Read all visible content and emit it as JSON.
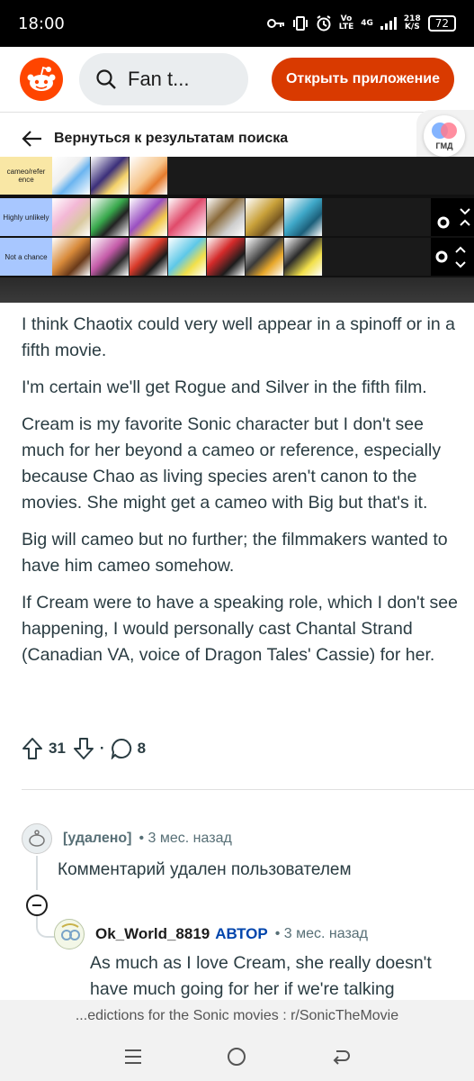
{
  "status": {
    "time": "18:00",
    "network_top": "Vo",
    "network_bottom": "LTE",
    "signal_label": "4G",
    "speed_top": "218",
    "speed_bottom": "K/S",
    "battery": "72"
  },
  "header": {
    "search_text": "Fan t...",
    "open_app_label": "Открыть приложение"
  },
  "nav": {
    "back_label": "Вернуться к результатам поиска"
  },
  "widgets": {
    "gmd_label": "ГМД"
  },
  "tierlist": {
    "rows": [
      {
        "label": "cameo/refer ence",
        "color": "#f9e7a5",
        "count": 3
      },
      {
        "label": "Highly unlikely",
        "color": "#a8c7ff",
        "count": 6
      },
      {
        "label": "Not a chance",
        "color": "#a8c7ff",
        "count": 6
      }
    ]
  },
  "post": {
    "paragraphs": [
      "I think Chaotix could very well appear in a spinoff or in a fifth movie.",
      "I'm certain we'll get Rogue and Silver in the fifth film.",
      "Cream is my favorite Sonic character but I don't see much for her beyond a cameo or reference, especially because Chao as living species aren't canon to the movies. She might get a cameo with Big but that's it.",
      "Big will cameo but no further; the filmmakers wanted to have him cameo somehow.",
      "If Cream were to have a speaking role, which I don't see happening, I would personally cast Chantal Strand (Canadian VA, voice of Dragon Tales' Cassie) for her."
    ],
    "upvotes": "31",
    "separator": "·",
    "comments": "8"
  },
  "comments": [
    {
      "author": "[удалено]",
      "meta": "• 3 мес. назад",
      "text": "Комментарий удален пользователем"
    },
    {
      "author": "Ok_World_8819",
      "badge": "АВТОР",
      "meta": "• 3 мес. назад",
      "text": "As much as I love Cream, she really doesn't have much going for her if we're talking"
    }
  ],
  "footer": {
    "url_title": "...edictions for the Sonic movies : r/SonicTheMovie"
  }
}
